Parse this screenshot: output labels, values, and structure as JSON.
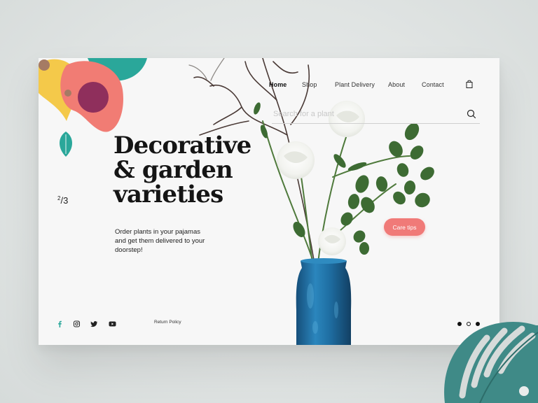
{
  "nav": {
    "items": [
      "Home",
      "Shop",
      "Plant Delivery",
      "About",
      "Contact"
    ],
    "active_index": 0
  },
  "search": {
    "placeholder": "Search for a plant",
    "value": ""
  },
  "hero": {
    "headline_lines": [
      "Decorative",
      "& garden",
      "varieties"
    ],
    "subtitle": "Order plants in your pajamas and get them delivered to your doorstep!",
    "cta_label": "Care tips"
  },
  "slider": {
    "current": "2",
    "total": "3",
    "dots_active_index": 1
  },
  "footer": {
    "social": [
      "facebook-icon",
      "instagram-icon",
      "twitter-icon",
      "youtube-icon"
    ],
    "return_policy": "Return Policy"
  },
  "colors": {
    "accent_coral": "#f07a78",
    "leaf_teal": "#2fa89b",
    "vase_blue": "#1f6fa3",
    "heading": "#151515"
  }
}
